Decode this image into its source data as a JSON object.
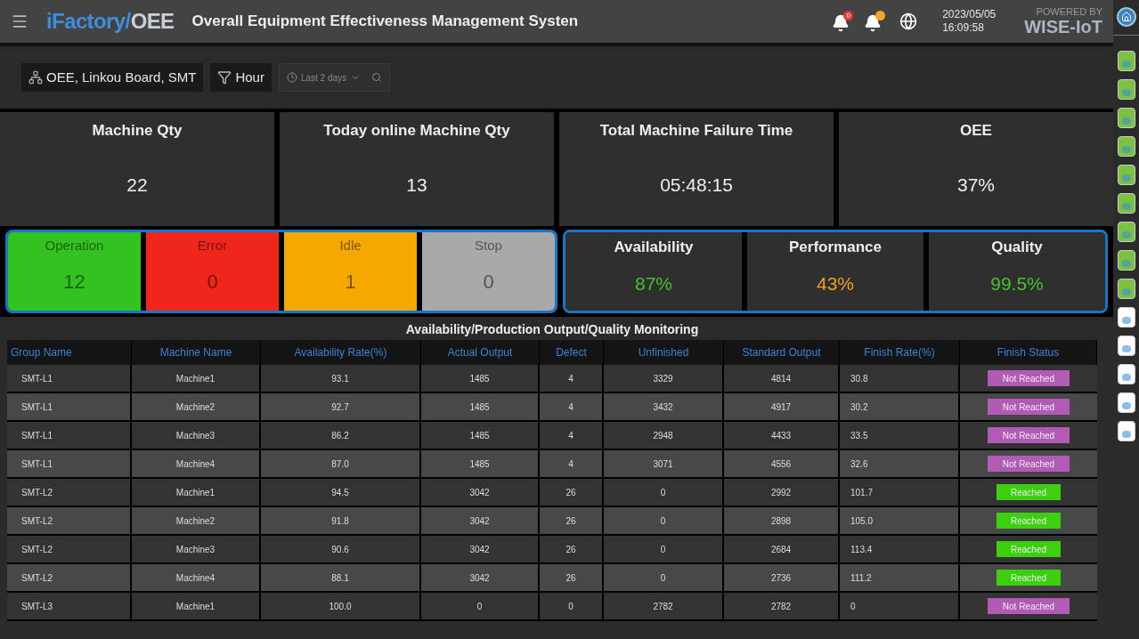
{
  "header": {
    "brand_main": "iFactory/",
    "brand_accent": "OEE",
    "title": "Overall Equipment Effectiveness Management Systen",
    "alerts": [
      {
        "count": "0",
        "color": "#e53935"
      },
      {
        "color": "#f5a623"
      }
    ],
    "date": "2023/05/05",
    "time": "16:09:58",
    "powered_by": "POWERED BY",
    "vendor": "WISE-IoT"
  },
  "filters": {
    "scope": "OEE, Linkou Board, SMT",
    "granularity": "Hour",
    "range": "Last 2 days"
  },
  "kpis": [
    {
      "label": "Machine Qty",
      "value": "22"
    },
    {
      "label": "Today online Machine Qty",
      "value": "13"
    },
    {
      "label": "Total Machine Failure Time",
      "value": "05:48:15"
    },
    {
      "label": "OEE",
      "value": "37%"
    }
  ],
  "states": [
    {
      "label": "Operation",
      "value": "12",
      "color": "#33c21f"
    },
    {
      "label": "Error",
      "value": "0",
      "color": "#f0251b"
    },
    {
      "label": "Idle",
      "value": "1",
      "color": "#f5a900"
    },
    {
      "label": "Stop",
      "value": "0",
      "color": "#a9a9a9"
    }
  ],
  "metrics": [
    {
      "label": "Availability",
      "value": "87%",
      "color": "#47c12c"
    },
    {
      "label": "Performance",
      "value": "43%",
      "color": "#f0a020"
    },
    {
      "label": "Quality",
      "value": "99.5%",
      "color": "#47c12c"
    }
  ],
  "table": {
    "title": "Availability/Production Output/Quality Monitoring",
    "columns": [
      "Group Name",
      "Machine Name",
      "Availability Rate(%)",
      "Actual Output",
      "Defect",
      "Unfinished",
      "Standard Output",
      "Finish Rate(%)",
      "Finish Status"
    ],
    "rows": [
      {
        "cells": [
          "SMT-L1",
          "Machine1",
          "93.1",
          "1485",
          "4",
          "3329",
          "4814",
          "30.8"
        ],
        "status": {
          "text": "Not Reached",
          "kind": "not_reached"
        }
      },
      {
        "cells": [
          "SMT-L1",
          "Machine2",
          "92.7",
          "1485",
          "4",
          "3432",
          "4917",
          "30.2"
        ],
        "status": {
          "text": "Not Reached",
          "kind": "not_reached"
        }
      },
      {
        "cells": [
          "SMT-L1",
          "Machine3",
          "86.2",
          "1485",
          "4",
          "2948",
          "4433",
          "33.5"
        ],
        "status": {
          "text": "Not Reached",
          "kind": "not_reached"
        }
      },
      {
        "cells": [
          "SMT-L1",
          "Machine4",
          "87.0",
          "1485",
          "4",
          "3071",
          "4556",
          "32.6"
        ],
        "status": {
          "text": "Not Reached",
          "kind": "not_reached"
        }
      },
      {
        "cells": [
          "SMT-L2",
          "Machine1",
          "94.5",
          "3042",
          "26",
          "0",
          "2992",
          "101.7"
        ],
        "status": {
          "text": "Reached",
          "kind": "reached"
        }
      },
      {
        "cells": [
          "SMT-L2",
          "Machine2",
          "91.8",
          "3042",
          "26",
          "0",
          "2898",
          "105.0"
        ],
        "status": {
          "text": "Reached",
          "kind": "reached"
        }
      },
      {
        "cells": [
          "SMT-L2",
          "Machine3",
          "90.6",
          "3042",
          "26",
          "0",
          "2684",
          "113.4"
        ],
        "status": {
          "text": "Reached",
          "kind": "reached"
        }
      },
      {
        "cells": [
          "SMT-L2",
          "Machine4",
          "88.1",
          "3042",
          "26",
          "0",
          "2736",
          "111.2"
        ],
        "status": {
          "text": "Reached",
          "kind": "reached"
        }
      },
      {
        "cells": [
          "SMT-L3",
          "Machine1",
          "100.0",
          "0",
          "0",
          "2782",
          "2782",
          "0"
        ],
        "status": {
          "text": "Not Reached",
          "kind": "not_reached"
        }
      }
    ]
  },
  "sidebar": {
    "apps": [
      {
        "color": "#7cc242"
      },
      {
        "color": "#7cc242"
      },
      {
        "color": "#7cc242"
      },
      {
        "color": "#7cc242"
      },
      {
        "color": "#7cc242"
      },
      {
        "color": "#7cc242"
      },
      {
        "color": "#7cc242"
      },
      {
        "color": "#7cc242"
      },
      {
        "color": "#7cc242"
      },
      {
        "color": "#ffffff"
      },
      {
        "color": "#ffffff"
      },
      {
        "color": "#ffffff"
      },
      {
        "color": "#ffffff"
      },
      {
        "color": "#ffffff"
      }
    ]
  }
}
